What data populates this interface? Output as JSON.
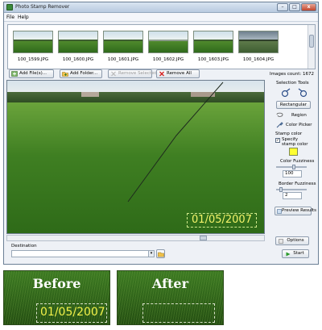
{
  "window": {
    "title": "Photo Stamp Remover",
    "controls": {
      "minimize": "–",
      "maximize": "□",
      "close": "x"
    }
  },
  "menu": [
    "File",
    "Help"
  ],
  "thumbnails": [
    "100_1599.JPG",
    "100_1600.JPG",
    "100_1601.JPG",
    "100_1602.JPG",
    "100_1603.JPG",
    "100_1604.JPG"
  ],
  "images_count": "Images count: 1672",
  "toolbar": {
    "add_files": "Add File(s)...",
    "add_folder": "Add Folder...",
    "remove_selected": "Remove Selected",
    "remove_all": "Remove All"
  },
  "preview": {
    "date_stamp": "01/05/2007"
  },
  "panel": {
    "selection_tools": "Selection Tools",
    "rectangular": "Rectangular",
    "region": "Region",
    "color_picker": "Color Picker",
    "stamp_color": "Stamp color",
    "specify_stamp_color": "Specify stamp color",
    "specify_stamp_checked": true,
    "stamp_color_hex": "#ffff33",
    "color_fuzziness_label": "Color Fuzziness",
    "color_fuzziness_value": "100",
    "border_fuzziness_label": "Border Fuzziness",
    "border_fuzziness_value": "2",
    "preview_results": "Preview Results",
    "options": "Options",
    "start": "Start"
  },
  "destination": {
    "label": "Destination",
    "value": ""
  },
  "comparison": {
    "before_label": "Before",
    "before_date": "01/05/2007",
    "after_label": "After"
  },
  "colors": {
    "accent_yellow": "#f3f36a",
    "grass_green": "#3c7a22",
    "remove_all_icon": "#d62020",
    "start_icon": "#2a9a2a"
  }
}
